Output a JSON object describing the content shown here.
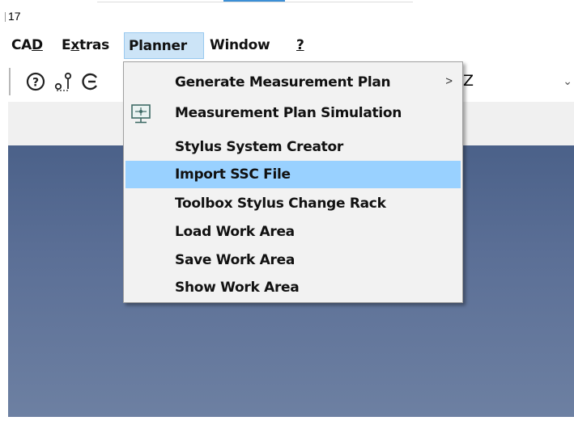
{
  "window": {
    "title_fragment": "17"
  },
  "menubar": {
    "items": [
      {
        "pre": "CA",
        "ul": "D",
        "post": ""
      },
      {
        "pre": "E",
        "ul": "x",
        "post": "tras"
      },
      {
        "pre": "Planner",
        "ul": "",
        "post": ""
      },
      {
        "pre": "Window",
        "ul": "",
        "post": ""
      },
      {
        "pre": "",
        "ul": "?",
        "post": ""
      }
    ]
  },
  "toolbar": {
    "icons": [
      "help-icon",
      "probe-icon",
      "rotate-icon"
    ],
    "combo_value": "Z"
  },
  "planner_menu": {
    "items": [
      {
        "label": "Generate Measurement Plan",
        "has_submenu": true,
        "highlighted": false
      },
      {
        "label": "Measurement Plan Simulation",
        "has_submenu": false,
        "highlighted": false,
        "icon": "monitor-icon"
      },
      {
        "label": "Stylus System Creator",
        "has_submenu": false,
        "highlighted": false
      },
      {
        "label": "Import SSC File",
        "has_submenu": false,
        "highlighted": true
      },
      {
        "label": "Toolbox Stylus Change Rack",
        "has_submenu": false,
        "highlighted": false
      },
      {
        "label": "Load Work Area",
        "has_submenu": false,
        "highlighted": false
      },
      {
        "label": "Save Work Area",
        "has_submenu": false,
        "highlighted": false
      },
      {
        "label": "Show Work Area",
        "has_submenu": false,
        "highlighted": false
      }
    ],
    "submenu_arrow": ">"
  },
  "colors": {
    "highlight": "#99d1ff",
    "menu_active": "#cce4f7",
    "viewport_top": "#4b6189",
    "viewport_bottom": "#6d80a2"
  }
}
